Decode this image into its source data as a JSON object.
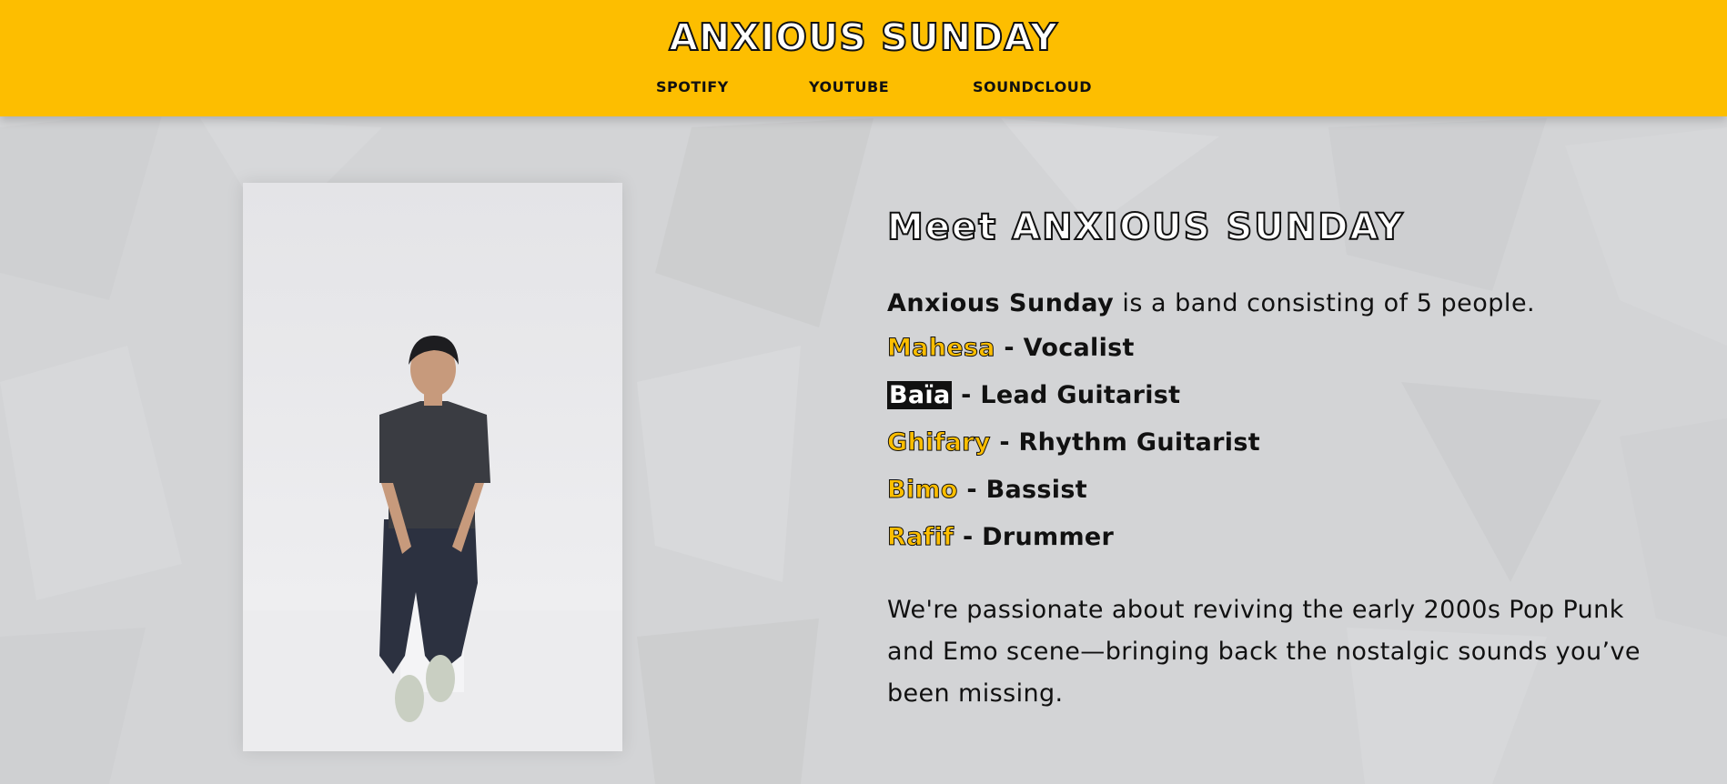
{
  "header": {
    "brand": "ANXIOUS SUNDAY",
    "nav": [
      "SPOTIFY",
      "YOUTUBE",
      "SOUNDCLOUD"
    ],
    "background_color": "#fdbe00"
  },
  "about": {
    "heading": "Meet ANXIOUS SUNDAY",
    "intro_band": "Anxious Sunday",
    "intro_rest": " is a band consisting of 5 people.",
    "members": [
      {
        "name": "Mahesa",
        "role": " - Vocalist"
      },
      {
        "name": "Baïa",
        "role": " - Lead Guitarist"
      },
      {
        "name": "Ghifary",
        "role": " - Rhythm Guitarist"
      },
      {
        "name": "Bimo",
        "role": " - Bassist"
      },
      {
        "name": "Rafif",
        "role": " - Drummer"
      }
    ],
    "description": "We're passionate about reviving the early 2000s Pop Punk and Emo scene—bringing back the nostalgic sounds you’ve been missing."
  }
}
